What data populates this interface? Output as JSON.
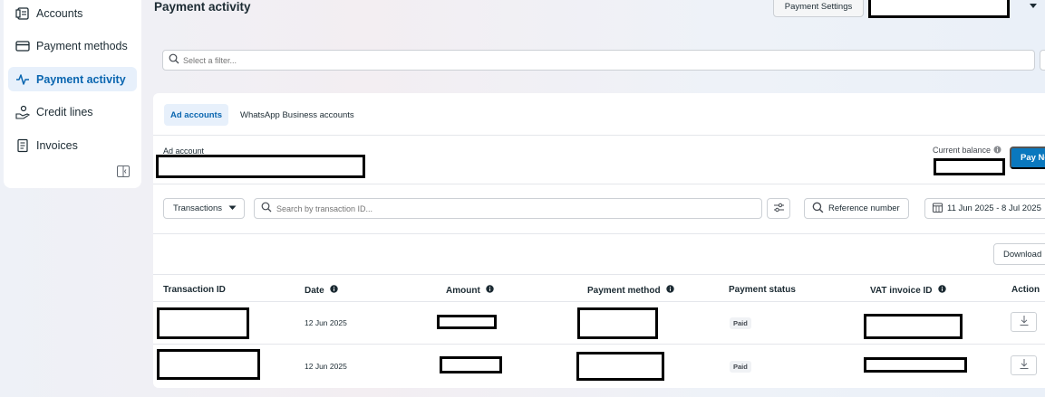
{
  "sidebar": {
    "items": [
      {
        "label": "Accounts",
        "icon": "accounts-icon",
        "active": false
      },
      {
        "label": "Payment methods",
        "icon": "card-icon",
        "active": false
      },
      {
        "label": "Payment activity",
        "icon": "activity-icon",
        "active": true
      },
      {
        "label": "Credit lines",
        "icon": "credit-lines-icon",
        "active": false
      },
      {
        "label": "Invoices",
        "icon": "invoice-icon",
        "active": false
      }
    ]
  },
  "header": {
    "title": "Payment activity",
    "settings_label": "Payment Settings"
  },
  "filter": {
    "placeholder": "Select a filter..."
  },
  "tabs": [
    {
      "label": "Ad accounts",
      "active": true
    },
    {
      "label": "WhatsApp Business accounts",
      "active": false
    }
  ],
  "account": {
    "ad_account_label": "Ad account",
    "balance_label": "Current balance",
    "pay_label": "Pay No"
  },
  "controls": {
    "transactions_label": "Transactions",
    "search_placeholder": "Search by transaction ID...",
    "reference_label": "Reference number",
    "date_range": "11 Jun 2025 - 8 Jul 2025",
    "download_label": "Download"
  },
  "table": {
    "columns": [
      "Transaction ID",
      "Date",
      "Amount",
      "Payment method",
      "Payment status",
      "VAT invoice ID",
      "Action"
    ],
    "rows": [
      {
        "date": "12 Jun 2025",
        "status": "Paid"
      },
      {
        "date": "12 Jun 2025",
        "status": "Paid"
      }
    ]
  },
  "colors": {
    "accent": "#0a78be",
    "active_bg": "#e7f0fb",
    "active_text": "#0a66b0"
  }
}
